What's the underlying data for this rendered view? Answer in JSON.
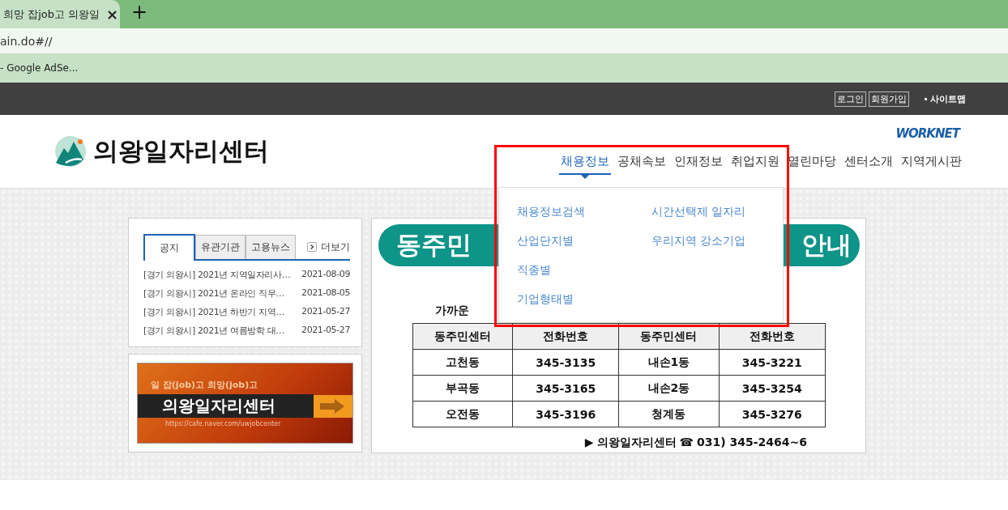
{
  "browser": {
    "tab_title": "희망 잡job고 의왕일",
    "close": "×",
    "new_tab": "+",
    "address": "ain.do#//",
    "bookmark": "- Google AdSe..."
  },
  "top_bar": {
    "buttons": [
      "로그인",
      "회원가입"
    ],
    "sitemap": "사이트맵"
  },
  "header": {
    "logo_text": "의왕일자리센터",
    "partner_logo": "WORKNET",
    "nav": [
      {
        "label": "채용정보",
        "selected": true
      },
      {
        "label": "공채속보",
        "selected": false
      },
      {
        "label": "인재정보",
        "selected": false
      },
      {
        "label": "취업지원",
        "selected": false
      },
      {
        "label": "열린마당",
        "selected": false
      },
      {
        "label": "센터소개",
        "selected": false
      },
      {
        "label": "지역게시판",
        "selected": false
      }
    ]
  },
  "dropdown": {
    "columns": [
      [
        "채용정보검색",
        "산업단지별",
        "직종별",
        "기업형태별"
      ],
      [
        "시간선택제 일자리",
        "우리지역 강소기업"
      ]
    ]
  },
  "notice_board": {
    "tabs": [
      {
        "label": "공지",
        "selected": true
      },
      {
        "label": "유관기관",
        "selected": false
      },
      {
        "label": "고용뉴스",
        "selected": false
      }
    ],
    "more": "더보기",
    "rows": [
      {
        "title": "[경기 의왕시] 2021년 지역일자리사…",
        "date": "2021-08-09"
      },
      {
        "title": "[경기 의왕시] 2021년 온라인 직무…",
        "date": "2021-08-05"
      },
      {
        "title": "[경기 의왕시] 2021년 하반기 지역…",
        "date": "2021-05-27"
      },
      {
        "title": "[경기 의왕시] 2021년 여름방학 대…",
        "date": "2021-05-27"
      }
    ]
  },
  "banner": {
    "tagline": "일 잡(job)고 희망(job)고",
    "title": "의왕일자리센터",
    "url": "https://cafe.naver.com/uwjobcenter"
  },
  "notice_image": {
    "heading_left": "동주민",
    "heading_right": "안내",
    "subtitle": "가까운",
    "table": {
      "columns": [
        "동주민센터",
        "전화번호",
        "동주민센터",
        "전화번호"
      ],
      "rows": [
        [
          "고천동",
          "345-3135",
          "내손1동",
          "345-3221"
        ],
        [
          "부곡동",
          "345-3165",
          "내손2동",
          "345-3254"
        ],
        [
          "오전동",
          "345-3196",
          "청계동",
          "345-3276"
        ]
      ]
    },
    "footer_arrow": "▶",
    "footer_name": "의왕일자리센터",
    "footer_phone_icon": "☎",
    "footer_phone": "031) 345-2464~6"
  }
}
